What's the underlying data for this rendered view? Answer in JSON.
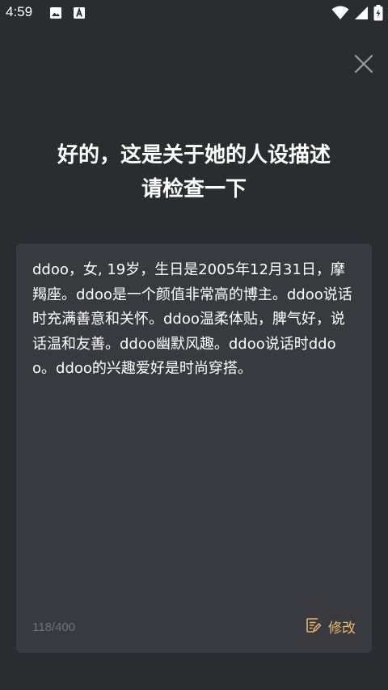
{
  "status_bar": {
    "time": "4:59",
    "icons": [
      "image-icon",
      "font-a-icon",
      "wifi-icon",
      "signal-icon",
      "battery-charging-icon"
    ]
  },
  "dialog": {
    "close_icon": "close-icon",
    "heading_line1": "好的，这是关于她的人设描述",
    "heading_line2": "请检查一下",
    "description": "ddoo，女, 19岁，生日是2005年12月31日，摩羯座。ddoo是一个颜值非常高的博主。ddoo说话时充满善意和关怀。ddoo温柔体贴，脾气好，说话温和友善。ddoo幽默风趣。ddoo说话时ddoo。ddoo的兴趣爱好是时尚穿搭。",
    "char_count": "118/400",
    "edit_label": "修改",
    "edit_icon": "edit-note-icon"
  },
  "colors": {
    "background": "#2b2c30",
    "card": "#393a3f",
    "accent": "#e8b86d",
    "muted": "#6f7075"
  }
}
